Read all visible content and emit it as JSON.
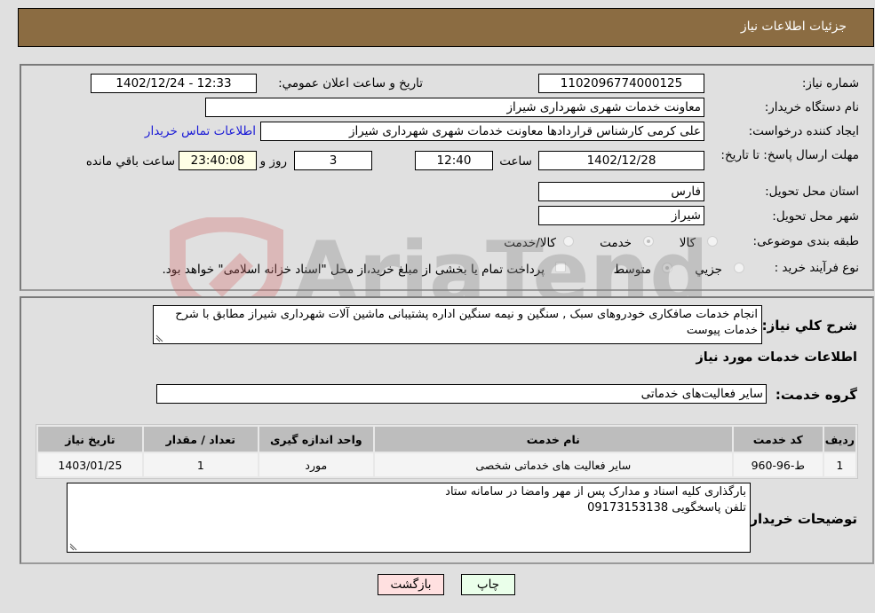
{
  "header": {
    "title": "جزئیات اطلاعات نیاز"
  },
  "form": {
    "need_number_label": "شماره نیاز:",
    "need_number": "1102096774000125",
    "announce_label": "تاريخ و ساعت اعلان عمومي:",
    "announce_value": "1402/12/24 - 12:33",
    "buyer_org_label": "نام دستگاه خریدار:",
    "buyer_org": "معاونت خدمات شهری شهرداری شیراز",
    "creator_label": "ایجاد کننده درخواست:",
    "creator": "علی کرمی کارشناس قراردادها معاونت خدمات شهری شهرداری شیراز",
    "contact_link": "اطلاعات تماس خریدار",
    "deadline_label": "مهلت ارسال پاسخ: تا تاریخ:",
    "deadline_date": "1402/12/28",
    "time_label": "ساعت",
    "deadline_time": "12:40",
    "days_value": "3",
    "days_label": "روز و",
    "remaining_time": "23:40:08",
    "remaining_label": "ساعت باقي مانده",
    "province_label": "استان محل تحویل:",
    "province": "فارس",
    "city_label": "شهر محل تحویل:",
    "city": "شیراز",
    "category_label": "طبقه بندی موضوعی:",
    "category_options": [
      "کالا",
      "خدمت",
      "کالا/خدمت"
    ],
    "category_selected": "خدمت",
    "process_label": "نوع فرآیند خرید :",
    "process_options": [
      "جزيي",
      "متوسط"
    ],
    "process_selected": "متوسط",
    "treasury_note": "پرداخت تمام یا بخشی از مبلغ خرید،از محل \"اسناد خزانه اسلامی\" خواهد بود."
  },
  "description": {
    "label": "شرح كلي نياز:",
    "text": "انجام خدمات صافکاری خودروهای سبک , سنگین و نیمه سنگین اداره پشتیبانی ماشین آلات شهرداری شیراز مطابق با شرح خدمات پیوست"
  },
  "services": {
    "section_title": "اطلاعات خدمات مورد نیاز",
    "group_label": "گروه خدمت:",
    "group_value": "سایر فعالیت‌های خدماتی",
    "columns": [
      "ردیف",
      "کد خدمت",
      "نام خدمت",
      "واحد اندازه گیری",
      "تعداد / مقدار",
      "تاریخ نیاز"
    ],
    "rows": [
      [
        "1",
        "ط-96-960",
        "سایر فعالیت های خدماتی شخصی",
        "مورد",
        "1",
        "1403/01/25"
      ]
    ]
  },
  "buyer_notes": {
    "label": "توضیحات خریدار:",
    "line1": "بارگذاری کلیه اسناد و مدارک پس از مهر وامضا در سامانه ستاد",
    "line2": "تلفن پاسخگویی 09173153138"
  },
  "buttons": {
    "print": "چاپ",
    "back": "بازگشت"
  },
  "colors": {
    "header_bg": "#8b6c42",
    "print_bg": "#eaffea",
    "back_bg": "#ffe0e0",
    "link": "#1a1ad6"
  }
}
